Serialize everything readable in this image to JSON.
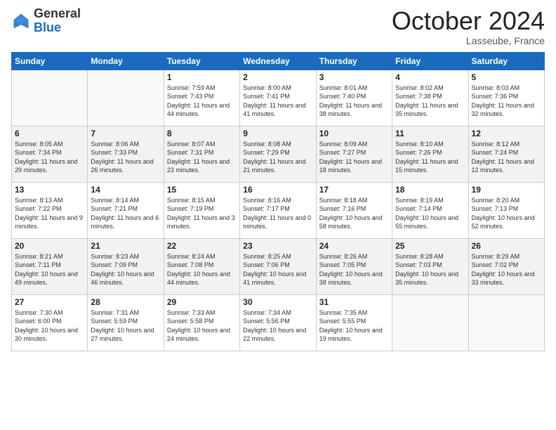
{
  "logo": {
    "general": "General",
    "blue": "Blue"
  },
  "header": {
    "month": "October 2024",
    "location": "Lasseube, France"
  },
  "days_of_week": [
    "Sunday",
    "Monday",
    "Tuesday",
    "Wednesday",
    "Thursday",
    "Friday",
    "Saturday"
  ],
  "weeks": [
    [
      {
        "day": "",
        "info": ""
      },
      {
        "day": "",
        "info": ""
      },
      {
        "day": "1",
        "info": "Sunrise: 7:59 AM\nSunset: 7:43 PM\nDaylight: 11 hours and 44 minutes."
      },
      {
        "day": "2",
        "info": "Sunrise: 8:00 AM\nSunset: 7:41 PM\nDaylight: 11 hours and 41 minutes."
      },
      {
        "day": "3",
        "info": "Sunrise: 8:01 AM\nSunset: 7:40 PM\nDaylight: 11 hours and 38 minutes."
      },
      {
        "day": "4",
        "info": "Sunrise: 8:02 AM\nSunset: 7:38 PM\nDaylight: 11 hours and 35 minutes."
      },
      {
        "day": "5",
        "info": "Sunrise: 8:03 AM\nSunset: 7:36 PM\nDaylight: 11 hours and 32 minutes."
      }
    ],
    [
      {
        "day": "6",
        "info": "Sunrise: 8:05 AM\nSunset: 7:34 PM\nDaylight: 11 hours and 29 minutes."
      },
      {
        "day": "7",
        "info": "Sunrise: 8:06 AM\nSunset: 7:33 PM\nDaylight: 11 hours and 26 minutes."
      },
      {
        "day": "8",
        "info": "Sunrise: 8:07 AM\nSunset: 7:31 PM\nDaylight: 11 hours and 23 minutes."
      },
      {
        "day": "9",
        "info": "Sunrise: 8:08 AM\nSunset: 7:29 PM\nDaylight: 11 hours and 21 minutes."
      },
      {
        "day": "10",
        "info": "Sunrise: 8:09 AM\nSunset: 7:27 PM\nDaylight: 11 hours and 18 minutes."
      },
      {
        "day": "11",
        "info": "Sunrise: 8:10 AM\nSunset: 7:26 PM\nDaylight: 11 hours and 15 minutes."
      },
      {
        "day": "12",
        "info": "Sunrise: 8:12 AM\nSunset: 7:24 PM\nDaylight: 11 hours and 12 minutes."
      }
    ],
    [
      {
        "day": "13",
        "info": "Sunrise: 8:13 AM\nSunset: 7:22 PM\nDaylight: 11 hours and 9 minutes."
      },
      {
        "day": "14",
        "info": "Sunrise: 8:14 AM\nSunset: 7:21 PM\nDaylight: 11 hours and 6 minutes."
      },
      {
        "day": "15",
        "info": "Sunrise: 8:15 AM\nSunset: 7:19 PM\nDaylight: 11 hours and 3 minutes."
      },
      {
        "day": "16",
        "info": "Sunrise: 8:16 AM\nSunset: 7:17 PM\nDaylight: 11 hours and 0 minutes."
      },
      {
        "day": "17",
        "info": "Sunrise: 8:18 AM\nSunset: 7:16 PM\nDaylight: 10 hours and 58 minutes."
      },
      {
        "day": "18",
        "info": "Sunrise: 8:19 AM\nSunset: 7:14 PM\nDaylight: 10 hours and 55 minutes."
      },
      {
        "day": "19",
        "info": "Sunrise: 8:20 AM\nSunset: 7:13 PM\nDaylight: 10 hours and 52 minutes."
      }
    ],
    [
      {
        "day": "20",
        "info": "Sunrise: 8:21 AM\nSunset: 7:11 PM\nDaylight: 10 hours and 49 minutes."
      },
      {
        "day": "21",
        "info": "Sunrise: 8:23 AM\nSunset: 7:09 PM\nDaylight: 10 hours and 46 minutes."
      },
      {
        "day": "22",
        "info": "Sunrise: 8:24 AM\nSunset: 7:08 PM\nDaylight: 10 hours and 44 minutes."
      },
      {
        "day": "23",
        "info": "Sunrise: 8:25 AM\nSunset: 7:06 PM\nDaylight: 10 hours and 41 minutes."
      },
      {
        "day": "24",
        "info": "Sunrise: 8:26 AM\nSunset: 7:05 PM\nDaylight: 10 hours and 38 minutes."
      },
      {
        "day": "25",
        "info": "Sunrise: 8:28 AM\nSunset: 7:03 PM\nDaylight: 10 hours and 35 minutes."
      },
      {
        "day": "26",
        "info": "Sunrise: 8:29 AM\nSunset: 7:02 PM\nDaylight: 10 hours and 33 minutes."
      }
    ],
    [
      {
        "day": "27",
        "info": "Sunrise: 7:30 AM\nSunset: 6:00 PM\nDaylight: 10 hours and 30 minutes."
      },
      {
        "day": "28",
        "info": "Sunrise: 7:31 AM\nSunset: 5:59 PM\nDaylight: 10 hours and 27 minutes."
      },
      {
        "day": "29",
        "info": "Sunrise: 7:33 AM\nSunset: 5:58 PM\nDaylight: 10 hours and 24 minutes."
      },
      {
        "day": "30",
        "info": "Sunrise: 7:34 AM\nSunset: 5:56 PM\nDaylight: 10 hours and 22 minutes."
      },
      {
        "day": "31",
        "info": "Sunrise: 7:35 AM\nSunset: 5:55 PM\nDaylight: 10 hours and 19 minutes."
      },
      {
        "day": "",
        "info": ""
      },
      {
        "day": "",
        "info": ""
      }
    ]
  ]
}
